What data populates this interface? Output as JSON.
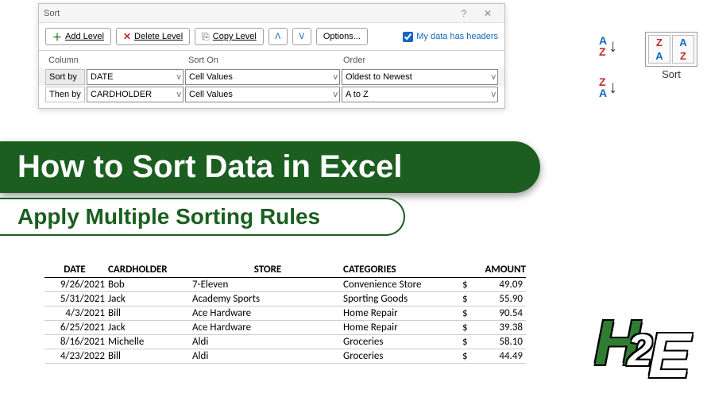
{
  "dialog": {
    "title": "Sort",
    "buttons": {
      "add": "Add Level",
      "delete": "Delete Level",
      "copy": "Copy Level",
      "options": "Options..."
    },
    "checkbox_label": "My data has headers",
    "headers": {
      "column": "Column",
      "sorton": "Sort On",
      "order": "Order"
    },
    "rows": [
      {
        "label": "Sort by",
        "column": "DATE",
        "sorton": "Cell Values",
        "order": "Oldest to Newest"
      },
      {
        "label": "Then by",
        "column": "CARDHOLDER",
        "sorton": "Cell Values",
        "order": "A to Z"
      }
    ]
  },
  "ribbon": {
    "sort_label": "Sort",
    "a": "A",
    "z": "Z"
  },
  "banner": {
    "title": "How to Sort Data in Excel",
    "subtitle": "Apply Multiple Sorting Rules"
  },
  "table": {
    "cols": {
      "date": "DATE",
      "holder": "CARDHOLDER",
      "store": "STORE",
      "cat": "CATEGORIES",
      "amt": "AMOUNT"
    },
    "rows": [
      {
        "date": "9/26/2021",
        "holder": "Bob",
        "store": "7-Eleven",
        "cat": "Convenience Store",
        "amt": "49.09"
      },
      {
        "date": "5/31/2021",
        "holder": "Jack",
        "store": "Academy Sports",
        "cat": "Sporting Goods",
        "amt": "55.90"
      },
      {
        "date": "4/3/2021",
        "holder": "Bill",
        "store": "Ace Hardware",
        "cat": "Home Repair",
        "amt": "90.54"
      },
      {
        "date": "6/25/2021",
        "holder": "Jack",
        "store": "Ace Hardware",
        "cat": "Home Repair",
        "amt": "39.38"
      },
      {
        "date": "8/16/2021",
        "holder": "Michelle",
        "store": "Aldi",
        "cat": "Groceries",
        "amt": "58.10"
      },
      {
        "date": "4/23/2022",
        "holder": "Bill",
        "store": "Aldi",
        "cat": "Groceries",
        "amt": "44.49"
      }
    ]
  },
  "currency": "$"
}
